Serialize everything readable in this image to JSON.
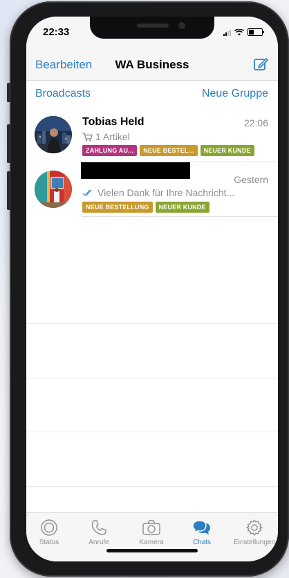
{
  "status_bar": {
    "time": "22:33"
  },
  "nav": {
    "edit_label": "Bearbeiten",
    "title": "WA Business",
    "compose_icon": "compose-icon"
  },
  "links": {
    "broadcasts": "Broadcasts",
    "new_group": "Neue Gruppe"
  },
  "chats": [
    {
      "name": "Tobias Held",
      "time": "22:06",
      "preview_icon": "cart-icon",
      "preview": "1 Artikel",
      "labels": [
        {
          "text": "ZAHLUNG AU...",
          "color": "#b4347f"
        },
        {
          "text": "NEUE BESTEL...",
          "color": "#c79a2b"
        },
        {
          "text": "NEUER KUNDE",
          "color": "#8aa632"
        }
      ]
    },
    {
      "name": "",
      "time": "Gestern",
      "preview_icon": "double-check-icon",
      "preview": "Vielen Dank für Ihre Nachricht...",
      "labels": [
        {
          "text": "NEUE BESTELLUNG",
          "color": "#c79a2b"
        },
        {
          "text": "NEUER KUNDE",
          "color": "#8aa632"
        }
      ]
    }
  ],
  "tabs": [
    {
      "label": "Status",
      "icon": "status-icon",
      "active": false
    },
    {
      "label": "Anrufe",
      "icon": "phone-icon",
      "active": false
    },
    {
      "label": "Kamera",
      "icon": "camera-icon",
      "active": false
    },
    {
      "label": "Chats",
      "icon": "chats-icon",
      "active": true
    },
    {
      "label": "Einstellungen",
      "icon": "gear-icon",
      "active": false
    }
  ],
  "colors": {
    "accent": "#2d7fc1",
    "muted": "#8e8e93"
  }
}
